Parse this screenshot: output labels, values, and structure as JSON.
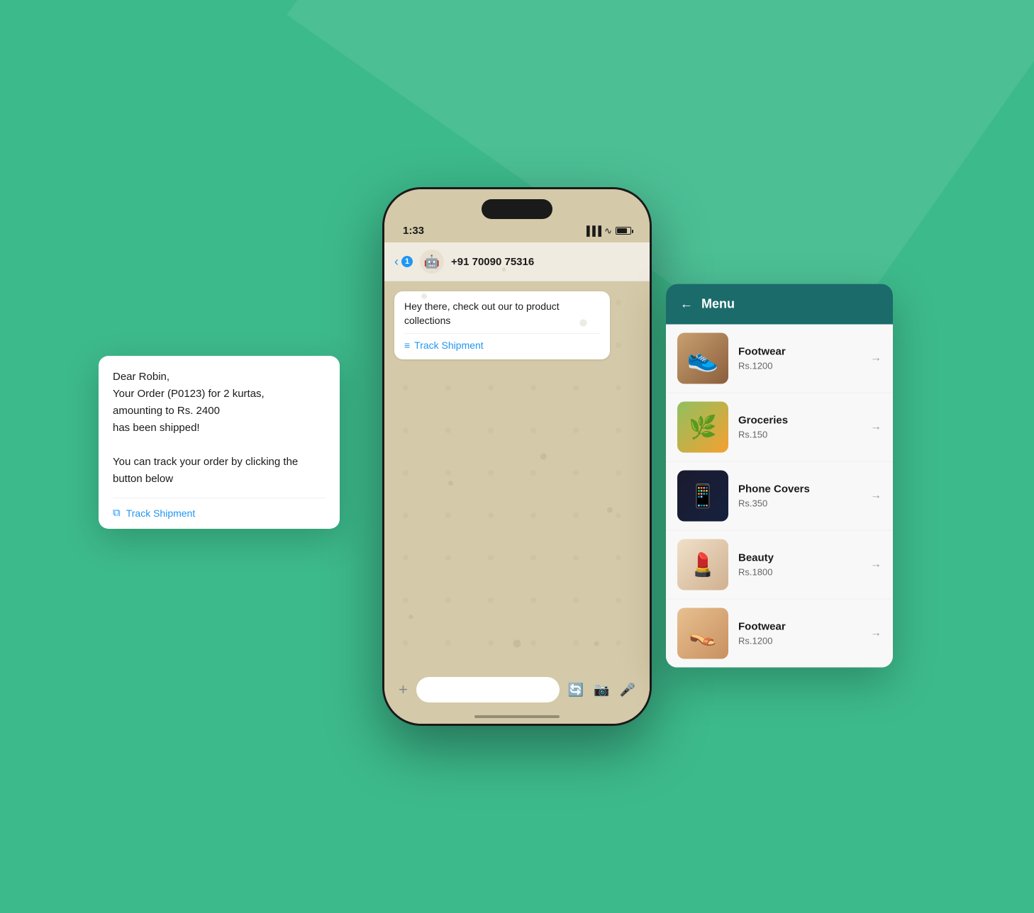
{
  "background_color": "#3dba8c",
  "phone": {
    "status_bar": {
      "time": "1:33",
      "signal_icon": "signal",
      "wifi_icon": "wifi",
      "battery_icon": "battery"
    },
    "chat_header": {
      "back_label": "‹",
      "badge_count": "1",
      "bot_emoji": "🤖",
      "contact_number": "+91 70090 75316"
    },
    "messages": [
      {
        "text": "Hey there, check out our to product collections",
        "link_label": "Track Shipment",
        "link_icon": "list-icon"
      }
    ],
    "bottom_bar": {
      "plus_label": "+",
      "placeholder": "",
      "icon1": "sticker",
      "icon2": "camera",
      "icon3": "mic"
    }
  },
  "message_card": {
    "greeting": "Dear Robin,",
    "line1": "Your Order (P0123) for 2 kurtas,",
    "line2": "amounting to Rs. 2400",
    "line3": "has been shipped!",
    "line4": "",
    "line5": "You can track your order by clicking the",
    "line6": "button below",
    "link_label": "Track Shipment",
    "link_icon": "external-link"
  },
  "menu_card": {
    "title": "Menu",
    "back_arrow": "←",
    "items": [
      {
        "name": "Footwear",
        "price": "Rs.1200",
        "emoji": "👟",
        "bg": "shoe"
      },
      {
        "name": "Groceries",
        "price": "Rs.150",
        "emoji": "🌿",
        "bg": "grocery"
      },
      {
        "name": "Phone Covers",
        "price": "Rs.350",
        "emoji": "📱",
        "bg": "phone"
      },
      {
        "name": "Beauty",
        "price": "Rs.1800",
        "emoji": "💄",
        "bg": "beauty"
      },
      {
        "name": "Footwear",
        "price": "Rs.1200",
        "emoji": "👠",
        "bg": "shoe2"
      }
    ],
    "arrow": "→"
  }
}
